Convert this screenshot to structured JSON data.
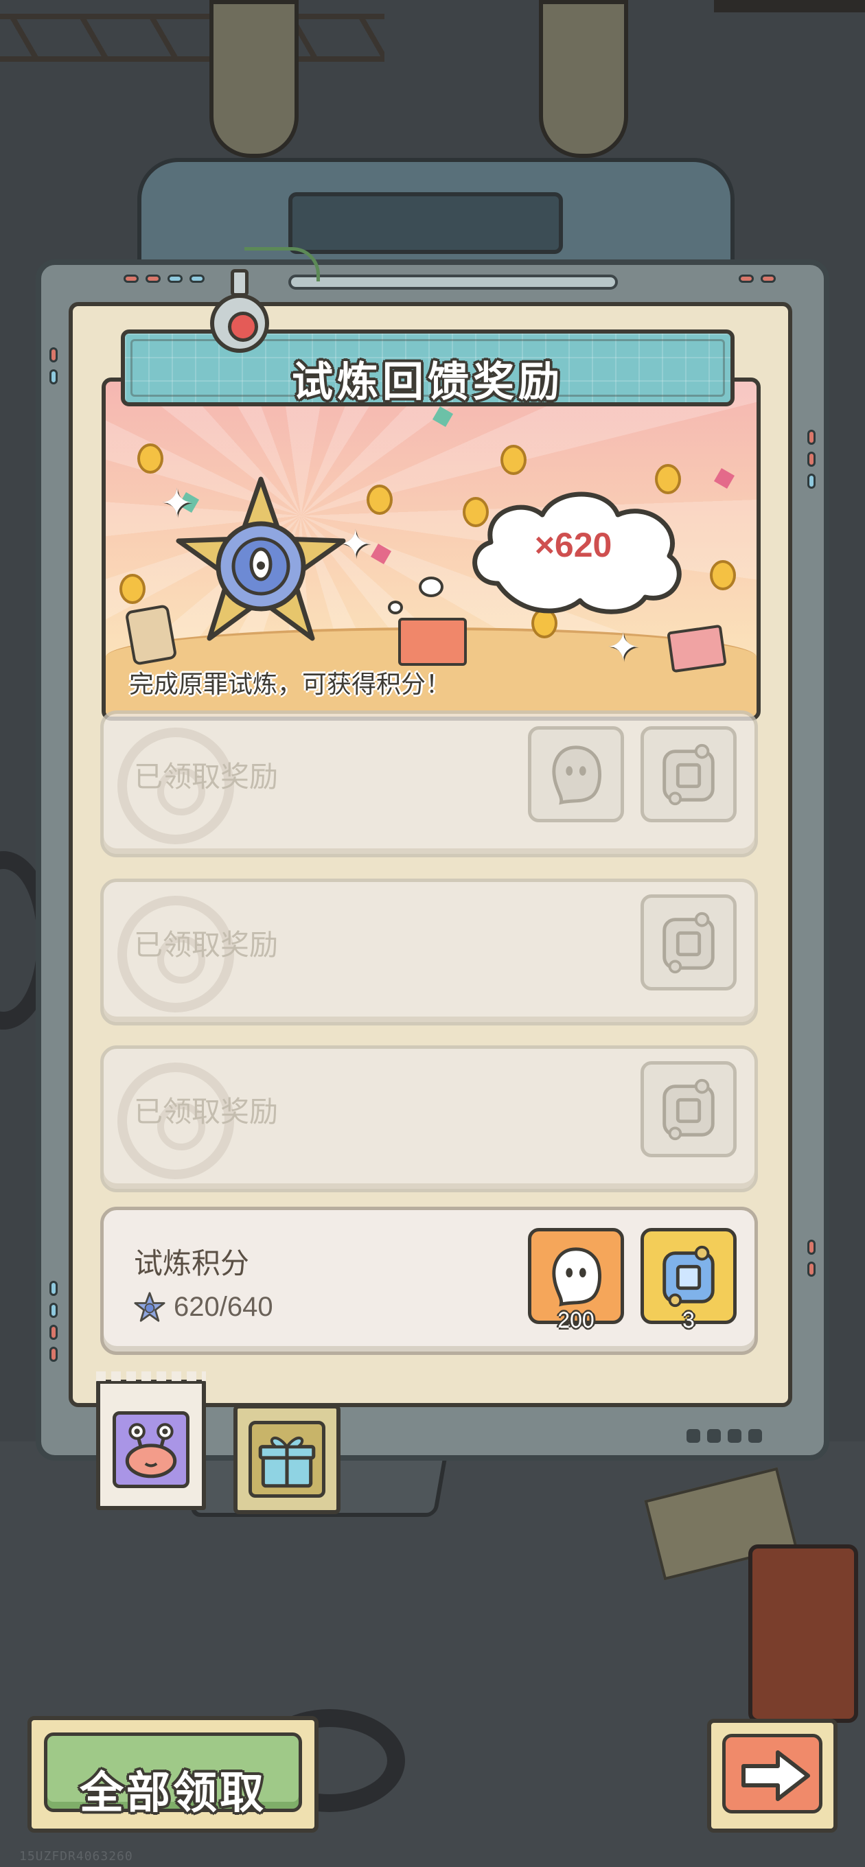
{
  "panel": {
    "title": "试炼回馈奖励",
    "banner": {
      "reward_multiplier": "×620",
      "description": "完成原罪试炼，可获得积分！"
    }
  },
  "reward_rows": [
    {
      "label": "已领取奖励",
      "status": "claimed",
      "items": [
        "ghost-icon",
        "relic-icon"
      ]
    },
    {
      "label": "已领取奖励",
      "status": "claimed",
      "items": [
        "relic-icon"
      ]
    },
    {
      "label": "已领取奖励",
      "status": "claimed",
      "items": [
        "relic-icon"
      ]
    }
  ],
  "trial_points": {
    "title": "试炼积分",
    "progress": "620/640",
    "current": 620,
    "target": 640,
    "rewards": [
      {
        "icon": "ghost-icon",
        "count": "200"
      },
      {
        "icon": "blue-relic-icon",
        "count": "3"
      }
    ]
  },
  "tabs": [
    {
      "icon": "snail-icon",
      "selected": true
    },
    {
      "icon": "gift-box-icon",
      "selected": false
    }
  ],
  "buttons": {
    "claim_all": "全部领取",
    "next": "arrow-right-icon"
  },
  "footer": {
    "watermark": "15UZFDR4063260"
  },
  "colors": {
    "title_plate": "#7ec5c9",
    "claim_button": "#9fc988",
    "next_button": "#f08a6a",
    "multiplier_text": "#cf4f4f"
  }
}
